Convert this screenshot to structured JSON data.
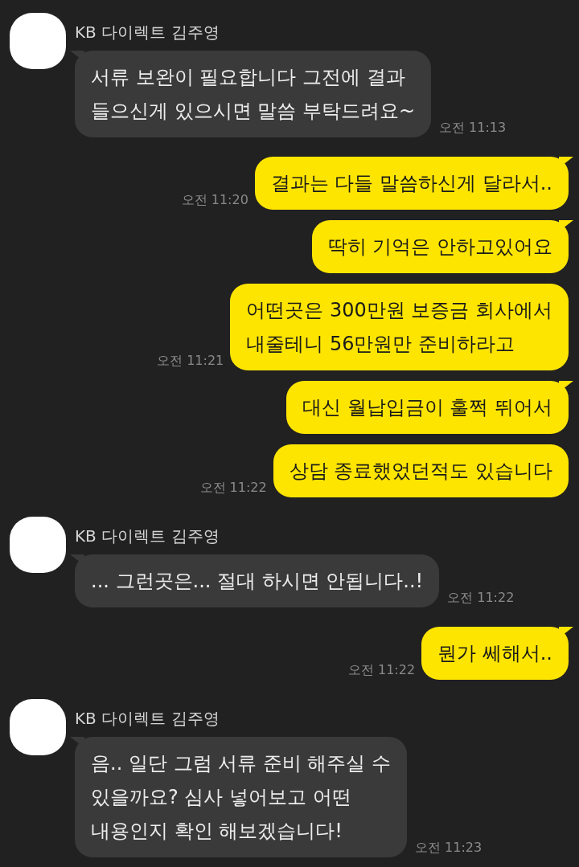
{
  "messages": [
    {
      "kind": "incoming",
      "sender": "KB 다이렉트 김주영",
      "lines": [
        "서류 보완이 필요합니다 그전에 결과",
        "들으신게 있으시면 말씀 부탁드려요~"
      ],
      "time": "오전 11:13",
      "tail": true
    },
    {
      "kind": "outgoing",
      "lines": [
        "결과는 다들 말씀하신게 달라서.."
      ],
      "time": "오전 11:20",
      "tail": true
    },
    {
      "kind": "outgoing",
      "lines": [
        "딱히 기억은 안하고있어요"
      ],
      "tail": true
    },
    {
      "kind": "outgoing",
      "lines": [
        "어떤곳은 300만원 보증금 회사에서",
        "내줄테니 56만원만 준비하라고"
      ],
      "time": "오전 11:21",
      "tail": false
    },
    {
      "kind": "outgoing",
      "lines": [
        "대신 월납입금이 훌쩍 뛰어서"
      ],
      "tail": true
    },
    {
      "kind": "outgoing",
      "lines": [
        "상담 종료했었던적도 있습니다"
      ],
      "time": "오전 11:22",
      "tail": false
    },
    {
      "kind": "incoming",
      "sender": "KB 다이렉트 김주영",
      "lines": [
        "... 그런곳은... 절대 하시면 안됩니다..!"
      ],
      "time": "오전 11:22",
      "tail": true
    },
    {
      "kind": "outgoing",
      "lines": [
        "뭔가 쎄해서.."
      ],
      "time": "오전 11:22",
      "tail": true
    },
    {
      "kind": "incoming",
      "sender": "KB 다이렉트 김주영",
      "lines": [
        "음.. 일단 그럼 서류 준비 해주실 수",
        "있을까요? 심사 넣어보고 어떤",
        "내용인지 확인 해보겠습니다!"
      ],
      "time": "오전 11:23",
      "tail": true
    }
  ]
}
